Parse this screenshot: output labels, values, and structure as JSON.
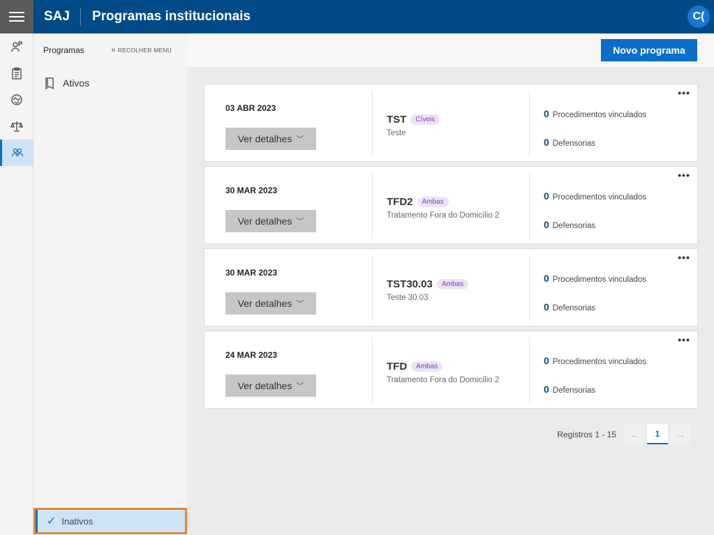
{
  "header": {
    "brand": "SAJ",
    "title": "Programas institucionais",
    "user_initials": "C("
  },
  "rail": {
    "items": [
      {
        "icon": "person-flag-icon"
      },
      {
        "icon": "clipboard-icon"
      },
      {
        "icon": "handshake-icon"
      },
      {
        "icon": "scales-icon"
      },
      {
        "icon": "people-icon",
        "active": true
      }
    ]
  },
  "sidemenu": {
    "title": "Programas",
    "collapse_label": "RECOLHER MENU",
    "items": [
      {
        "label": "Ativos",
        "icon": "bookmark-icon"
      }
    ],
    "footer_item": {
      "label": "Inativos",
      "icon": "check-icon"
    }
  },
  "toolbar": {
    "new_program_label": "Novo programa"
  },
  "programs": [
    {
      "date": "03 ABR 2023",
      "details_label": "Ver detalhes",
      "code": "TST",
      "tag": "Cíveis",
      "description": "Teste",
      "procedures_count": "0",
      "procedures_label": "Procedimentos vinculados",
      "defensorias_count": "0",
      "defensorias_label": "Defensorias"
    },
    {
      "date": "30 MAR 2023",
      "details_label": "Ver detalhes",
      "code": "TFD2",
      "tag": "Ambas",
      "description": "Tratamento Fora do Domicílio 2",
      "procedures_count": "0",
      "procedures_label": "Procedimentos vinculados",
      "defensorias_count": "0",
      "defensorias_label": "Defensorias"
    },
    {
      "date": "30 MAR 2023",
      "details_label": "Ver detalhes",
      "code": "TST30.03",
      "tag": "Ambas",
      "description": "Teste 30.03",
      "procedures_count": "0",
      "procedures_label": "Procedimentos vinculados",
      "defensorias_count": "0",
      "defensorias_label": "Defensorias"
    },
    {
      "date": "24 MAR 2023",
      "details_label": "Ver detalhes",
      "code": "TFD",
      "tag": "Ambas",
      "description": "Tratamento Fora do Domicílio 2",
      "procedures_count": "0",
      "procedures_label": "Procedimentos vinculados",
      "defensorias_count": "0",
      "defensorias_label": "Defensorias"
    }
  ],
  "pagination": {
    "records_label": "Registros 1 - 15",
    "current_page": "1",
    "prev_symbol": "←",
    "next_symbol": "→"
  },
  "colors": {
    "header_bg": "#004b87",
    "primary_button": "#0b6fc7",
    "tag_text": "#7a3fb3",
    "highlight_border": "#e8852f"
  }
}
